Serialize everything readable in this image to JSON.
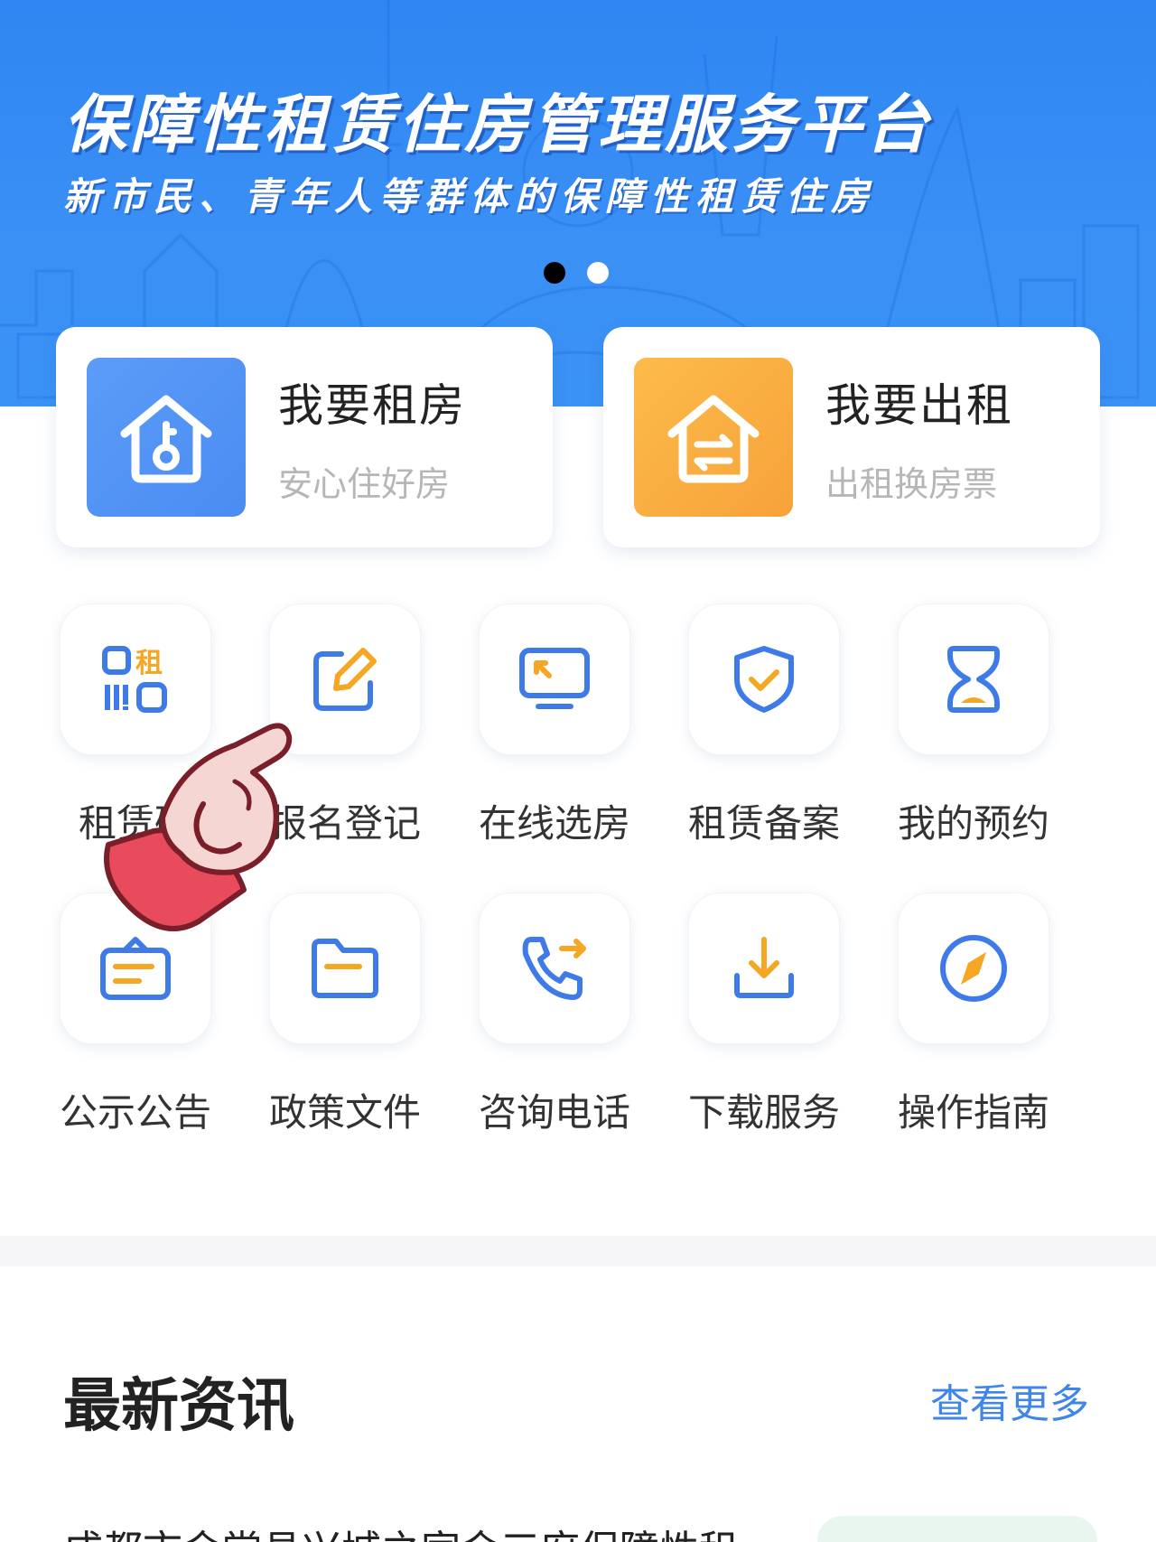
{
  "banner": {
    "title": "保障性租赁住房管理服务平台",
    "subtitle": "新市民、青年人等群体的保障性租赁住房",
    "dots": [
      true,
      false
    ]
  },
  "cards": [
    {
      "id": "rent",
      "title": "我要租房",
      "subtitle": "安心住好房",
      "icon": "house-key-icon",
      "color": "#4a8cf2"
    },
    {
      "id": "lease",
      "title": "我要出租",
      "subtitle": "出租换房票",
      "icon": "house-exchange-icon",
      "color": "#f7a23a"
    }
  ],
  "grid": {
    "items": [
      {
        "label": "租赁码",
        "icon": "rental-qr-code-icon"
      },
      {
        "label": "报名登记",
        "icon": "edit-register-icon"
      },
      {
        "label": "在线选房",
        "icon": "monitor-select-icon"
      },
      {
        "label": "租赁备案",
        "icon": "shield-check-icon"
      },
      {
        "label": "我的预约",
        "icon": "hourglass-icon"
      },
      {
        "label": "公示公告",
        "icon": "notice-board-icon"
      },
      {
        "label": "政策文件",
        "icon": "folder-icon"
      },
      {
        "label": "咨询电话",
        "icon": "phone-call-icon"
      },
      {
        "label": "下载服务",
        "icon": "download-icon"
      },
      {
        "label": "操作指南",
        "icon": "compass-icon"
      }
    ]
  },
  "news": {
    "title": "最新资讯",
    "more": "查看更多",
    "first_item": "成都市金堂县兴城之家金三府保障性租"
  },
  "colors": {
    "primary": "#3f86e6",
    "accent_orange": "#f7a23a"
  }
}
